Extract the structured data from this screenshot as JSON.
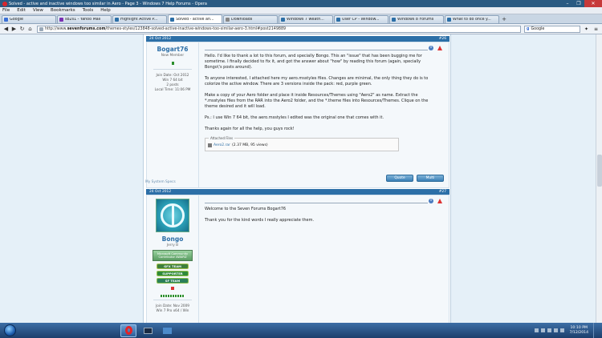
{
  "window": {
    "title": "Solved - active and inactive windows too similar in Aero - Page 3 - Windows 7 Help Forums - Opera",
    "controls": [
      "–",
      "❐",
      "✕"
    ]
  },
  "menu": [
    "File",
    "Edit",
    "View",
    "Bookmarks",
    "Tools",
    "Help"
  ],
  "tabs": [
    {
      "label": "Google",
      "color": "#3a6fd6",
      "active": false
    },
    {
      "label": "sb2s1 - Yahoo Mail",
      "color": "#7b2fb3",
      "active": false
    },
    {
      "label": "Highlight Active P...",
      "color": "#2c6fa7",
      "active": false
    },
    {
      "label": "Solved - active an...",
      "color": "#2c6fa7",
      "active": true
    },
    {
      "label": "Downloads",
      "color": "#888888",
      "active": false
    },
    {
      "label": "Windows 7 weath...",
      "color": "#2c6fa7",
      "active": false
    },
    {
      "label": "User CP - Window...",
      "color": "#2c6fa7",
      "active": false
    },
    {
      "label": "Windows 8 Forums",
      "color": "#2c6fa7",
      "active": false
    },
    {
      "label": "What to do once y...",
      "color": "#2c6fa7",
      "active": false
    }
  ],
  "address": {
    "url_prefix": "http://www.",
    "url_domain": "sevenforums.com",
    "url_rest": "/themes-styles/123848-solved-active-inactive-windows-too-similar-aero-3.html#post2149889",
    "search_placeholder": "Google"
  },
  "posts": [
    {
      "date": "24 Oct 2012",
      "number": "#26",
      "username": "Bogart76",
      "user_title": "New Member",
      "info": [
        "Join Date: Oct 2012",
        "Win 7 64 bit",
        "2 posts",
        "Local Time: 11:06 PM"
      ],
      "paragraphs": [
        "Hello. I'd like to thank a lot to this forum, and specially Bongo. This an \"issue\" that has been bugging me for sometime. I finally decided to fix it, and got the answer about \"how\" by reading this forum (again, specially Bongo\\'s posts around).",
        "To anyone interested, I attached here my aero.msstyles files. Changes are minimal, the only thing they do is to colorize the active window. There are 3 versions inside the pack: red, purple green.",
        "Make a copy of your Aero folder and place it inside Resources/Themes using \"Aero2\" as name. Extract the *.msstyles files from the RAR into the Aero2 folder, and the *.theme files into Resources/Themes. Clique on the theme desired and it will load.",
        "Ps.: I use Win 7 64 bit, the aero.msstyles I edited was the original one that comes with it.",
        "Thanks again for all the help, you guys rock!"
      ],
      "attachments_label": "Attached Files",
      "attachment_name": "Aero2.rar",
      "attachment_meta": "(2.37 MB, 95 views)",
      "quote_label": "Quote",
      "multi_label": "Multi",
      "specs_label": "My System Specs"
    },
    {
      "date": "24 Oct 2012",
      "number": "#27",
      "username": "Bongo",
      "user_title": "Jerry B",
      "mvp_text": "Microsoft Community Contributor AWARD",
      "badges": [
        "GFX TEAM",
        "SUPPORTER",
        "SF TEAM"
      ],
      "info": [
        "Join Date: Nov 2009",
        "Win 7 Pro x64 / Win"
      ],
      "paragraphs": [
        "Welcome to the Seven Forums Bogart76",
        "Thank you for the kind words I really appreciate them."
      ]
    }
  ],
  "taskbar": {
    "time": "10:10 PM",
    "date": "7/12/2014"
  }
}
